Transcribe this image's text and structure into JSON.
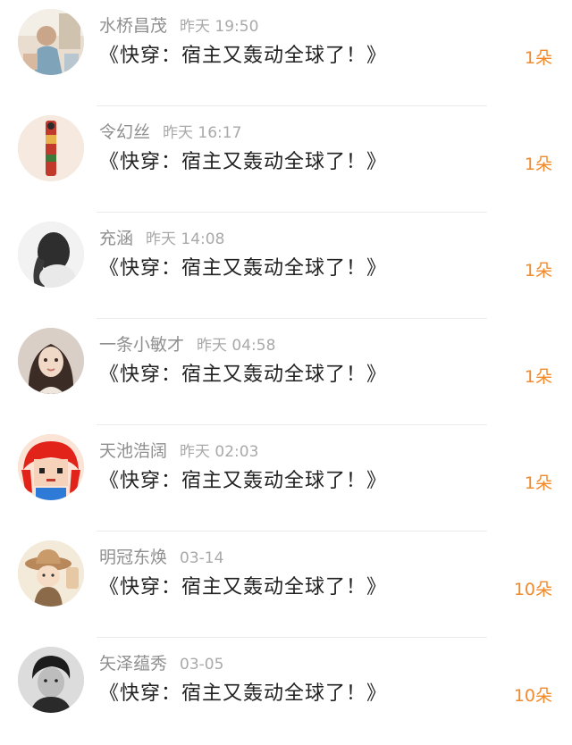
{
  "accent_color": "#f08a2c",
  "items": [
    {
      "user": "水桥昌茂",
      "time": "昨天 19:50",
      "title": "《快穿：宿主又轰动全球了！》",
      "count": "1朵",
      "avatar_icon": "avatar-photo-woman"
    },
    {
      "user": "令幻丝",
      "time": "昨天 16:17",
      "title": "《快穿：宿主又轰动全球了！》",
      "count": "1朵",
      "avatar_icon": "avatar-abstract-figure"
    },
    {
      "user": "充涵",
      "time": "昨天 14:08",
      "title": "《快穿：宿主又轰动全球了！》",
      "count": "1朵",
      "avatar_icon": "avatar-dark-hair-back"
    },
    {
      "user": "一条小敏才",
      "time": "昨天 04:58",
      "title": "《快穿：宿主又轰动全球了！》",
      "count": "1朵",
      "avatar_icon": "avatar-girl-portrait"
    },
    {
      "user": "天池浩阔",
      "time": "昨天 02:03",
      "title": "《快穿：宿主又轰动全球了！》",
      "count": "1朵",
      "avatar_icon": "avatar-pixel-red-hair"
    },
    {
      "user": "明冠东焕",
      "time": "03-14",
      "title": "《快穿：宿主又轰动全球了！》",
      "count": "10朵",
      "avatar_icon": "avatar-cartoon-hat"
    },
    {
      "user": "矢泽蕴秀",
      "time": "03-05",
      "title": "《快穿：宿主又轰动全球了！》",
      "count": "10朵",
      "avatar_icon": "avatar-bw-boy"
    }
  ]
}
